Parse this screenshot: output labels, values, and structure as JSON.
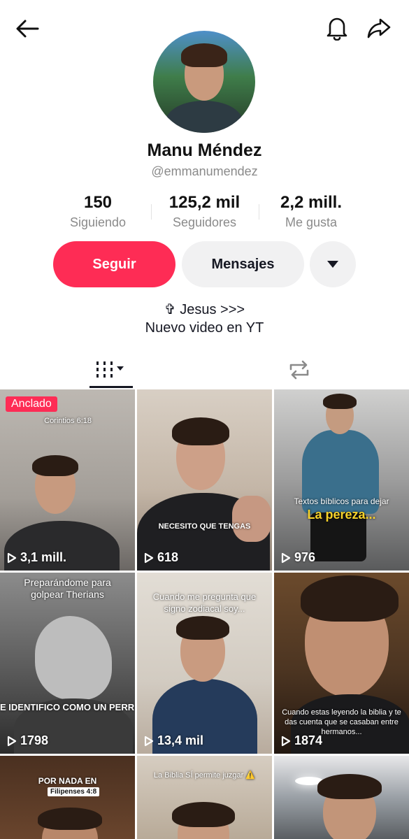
{
  "header": {
    "back_icon": "arrow-left-icon",
    "bell_icon": "bell-icon",
    "share_icon": "share-icon"
  },
  "profile": {
    "name": "Manu Méndez",
    "handle": "@emmanumendez",
    "stats": [
      {
        "value": "150",
        "label": "Siguiendo"
      },
      {
        "value": "125,2 mil",
        "label": "Seguidores"
      },
      {
        "value": "2,2 mill.",
        "label": "Me gusta"
      }
    ],
    "bio_line1": "✞ Jesus >>>",
    "bio_line2": "Nuevo video en YT"
  },
  "actions": {
    "follow_label": "Seguir",
    "message_label": "Mensajes",
    "follow_color": "#fe2c55"
  },
  "tabs": {
    "videos_icon": "grid-icon",
    "reposts_icon": "repost-icon"
  },
  "videos": [
    {
      "pinned_label": "Anclado",
      "overlay": "Corintios 6:18",
      "views": "3,1 mill."
    },
    {
      "overlay": "NECESITO QUE TENGAS",
      "views": "618"
    },
    {
      "overlay_top": "Textos bíblicos para dejar",
      "overlay_bottom": "La pereza...",
      "views": "976"
    },
    {
      "overlay": "Preparándome para golpear Therians",
      "overlay_bottom": "E IDENTIFICO COMO UN PERR",
      "views": "1798"
    },
    {
      "overlay": "Cuando me pregunta que signo zodiacal soy...",
      "views": "13,4 mil"
    },
    {
      "overlay": "Cuando estas leyendo la biblia y te das cuenta que se casaban entre hermanos...",
      "views": "1874"
    },
    {
      "overlay": "POR NADA EN",
      "overlay_sub": "Filipenses 4:8"
    },
    {
      "overlay": "La Biblia SÍ permite juzgar ⚠️"
    },
    {}
  ]
}
